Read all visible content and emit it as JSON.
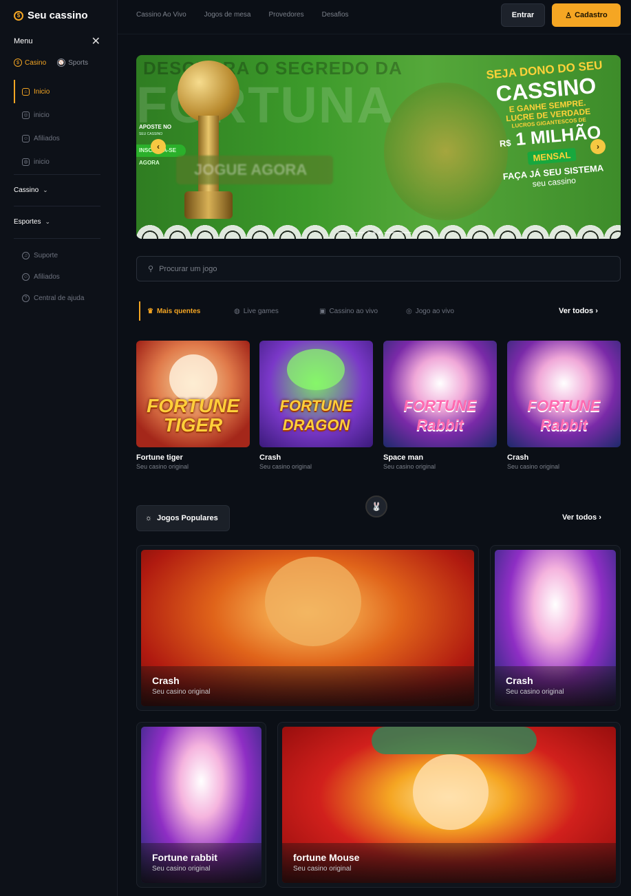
{
  "brand": {
    "name": "Seu cassino",
    "accent": "#f5a623"
  },
  "sidebar": {
    "menu_label": "Menu",
    "modes": [
      {
        "label": "Casino",
        "active": true
      },
      {
        "label": "Sports",
        "active": false
      }
    ],
    "items": [
      {
        "label": "Inicio",
        "active": true
      },
      {
        "label": "inicio"
      },
      {
        "label": "Afiliados"
      },
      {
        "label": "inicio"
      }
    ],
    "sections": [
      "Cassino",
      "Esportes"
    ],
    "footer_items": [
      "Suporte",
      "Afiliados",
      "Central de ajuda"
    ]
  },
  "topbar": {
    "links": [
      "Cassino Ao Vivo",
      "Jogos de mesa",
      "Provedores",
      "Desafios"
    ],
    "login": "Entrar",
    "signup": "Cadastro"
  },
  "banner": {
    "headline_top": "DESCUBRA O SEGREDO DA",
    "headline_big": "FORTUNA",
    "left_small": "APOSTE NO",
    "left_small_sub": "SEU CASSINO",
    "left_pill": "INSCREVA-SE AGORA",
    "cta": "JOGUE AGORA",
    "r1": "SEJA DONO DO SEU",
    "r2": "CASSINO",
    "r3a": "E GANHE SEMPRE.",
    "r3b": "LUCRE DE VERDADE",
    "r4": "LUCROS GIGANTESCOS DE",
    "r5_currency": "R$",
    "r5": "1 MILHÃO",
    "r6": "MENSAL",
    "r7": "FAÇA JÁ SEU SISTEMA",
    "r8": "seu cassino",
    "prev": "‹",
    "next": "›"
  },
  "search": {
    "placeholder": "Procurar um jogo"
  },
  "tabs": {
    "items": [
      "Mais quentes",
      "Live games",
      "Cassino ao vivo",
      "Jogo ao vivo"
    ],
    "see_all": "Ver todos"
  },
  "hot_games": [
    {
      "name": "Fortune tiger",
      "sub": "Seu casino original",
      "art_title": "FORTUNE TIGER"
    },
    {
      "name": "Crash",
      "sub": "Seu casino original",
      "art_title": "FORTUNE DRAGON"
    },
    {
      "name": "Space man",
      "sub": "Seu casino original",
      "art_title": "FORTUNE Rabbit"
    },
    {
      "name": "Crash",
      "sub": "Seu casino original",
      "art_title": "FORTUNE Rabbit"
    }
  ],
  "popular": {
    "label": "Jogos Populares",
    "see_all": "Ver todos",
    "games": [
      {
        "name": "Crash",
        "sub": "Seu casino original"
      },
      {
        "name": "Crash",
        "sub": "Seu casino original"
      },
      {
        "name": "Fortune rabbit",
        "sub": "Seu casino original"
      },
      {
        "name": "fortune Mouse",
        "sub": "Seu casino original"
      }
    ]
  }
}
